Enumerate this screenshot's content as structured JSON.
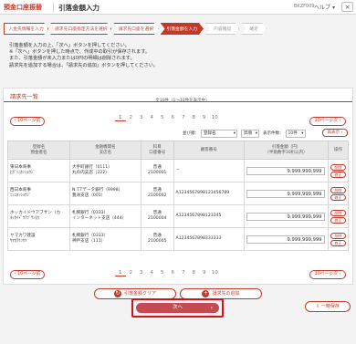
{
  "header": {
    "section": "預金口座振替",
    "title": "引落金額入力",
    "code": "BKZF009",
    "help": "ヘルプ",
    "close": "×"
  },
  "steps": [
    {
      "label": "入金先情報を入力",
      "state": "done"
    },
    {
      "label": "請求先口座指定方法を選択",
      "state": "done"
    },
    {
      "label": "請求先口座を選択",
      "state": "done"
    },
    {
      "label": "引落金額を入力",
      "state": "active"
    },
    {
      "label": "内容確認",
      "state": "future"
    },
    {
      "label": "確定",
      "state": "future"
    }
  ],
  "intro": [
    "引落金額を入力の上、「次へ」ボタンを押してください。",
    "※「次へ」ボタンを押した時点で、作成中の取引が保存されます。",
    "また、引落金額が未入力または0円の明細は削除されます。",
    "請求先を追加する場合は、「請求先の追加」ボタンを押してください。"
  ],
  "panel": {
    "title": "請求先一覧",
    "prev10": "10ページ前",
    "next10": "10ページ次",
    "count": "全10件（1～10件を表示中）",
    "pages": [
      "1",
      "2",
      "3",
      "4",
      "5",
      "6",
      "7",
      "8",
      "9",
      "10"
    ],
    "current_page": "1",
    "sort_label": "並び順：",
    "sort_value": "登録名",
    "sort_order": "昇順",
    "per_page_label": "表示件数：",
    "per_page_value": "10件",
    "resort": "再表示"
  },
  "table": {
    "headers": {
      "name": [
        "登録名",
        "預金者名"
      ],
      "bank": [
        "金融機関名",
        "支店名"
      ],
      "type": [
        "科目",
        "口座番号"
      ],
      "customer": [
        "顧客番号"
      ],
      "amount": [
        "引落金額（円）",
        "（半角数字10桁以内）"
      ],
      "op": [
        "操作"
      ]
    },
    "rows": [
      {
        "name": [
          "東日本商事",
          "ﾋｶﾞｼﾆﾎﾝｼｮｳｼﾞ"
        ],
        "bank": [
          "大手町銀行（0111）",
          "丸の内支店（222）"
        ],
        "type": [
          "普通",
          "2100001"
        ],
        "customer": "－",
        "amount": "9,999,999,999"
      },
      {
        "name": [
          "西日本商事",
          "ﾆｼﾆﾎﾝｼｮｳｼﾞ"
        ],
        "bank": [
          "N.T.Tデータ銀行（9998）",
          "豊洲支店（001）"
        ],
        "type": [
          "普通",
          "2100002"
        ],
        "customer": "A1234567898123456789",
        "amount": "9,999,999,999"
      },
      {
        "name": [
          "ホッカイドウアブサン（カ",
          "ﾎｯｶｲﾄﾞｳｱﾌﾞｻﾝ(ｶ"
        ],
        "bank": [
          "札幌銀行（0333）",
          "インターネット支店（444）"
        ],
        "type": [
          "普通",
          "2100004"
        ],
        "customer": "A1234567898123345",
        "amount": "9,999,999,999"
      },
      {
        "name": [
          "ヤマカワ建設",
          "ﾔﾏｶﾜｹﾝｾﾂ"
        ],
        "bank": [
          "札幌銀行（0333）",
          "神戸支店（111）"
        ],
        "type": [
          "普通",
          "2100005"
        ],
        "customer": "A1234567898333333",
        "amount": "9,999,999,999"
      }
    ],
    "op_delete": "削除",
    "op_edit": "修正"
  },
  "actions": {
    "clear": "引落金額クリア",
    "add": "請求先の追加",
    "next": "次へ",
    "save": "一時保存"
  },
  "colors": {
    "accent": "#c0392b",
    "highlight": "#d0121b"
  }
}
